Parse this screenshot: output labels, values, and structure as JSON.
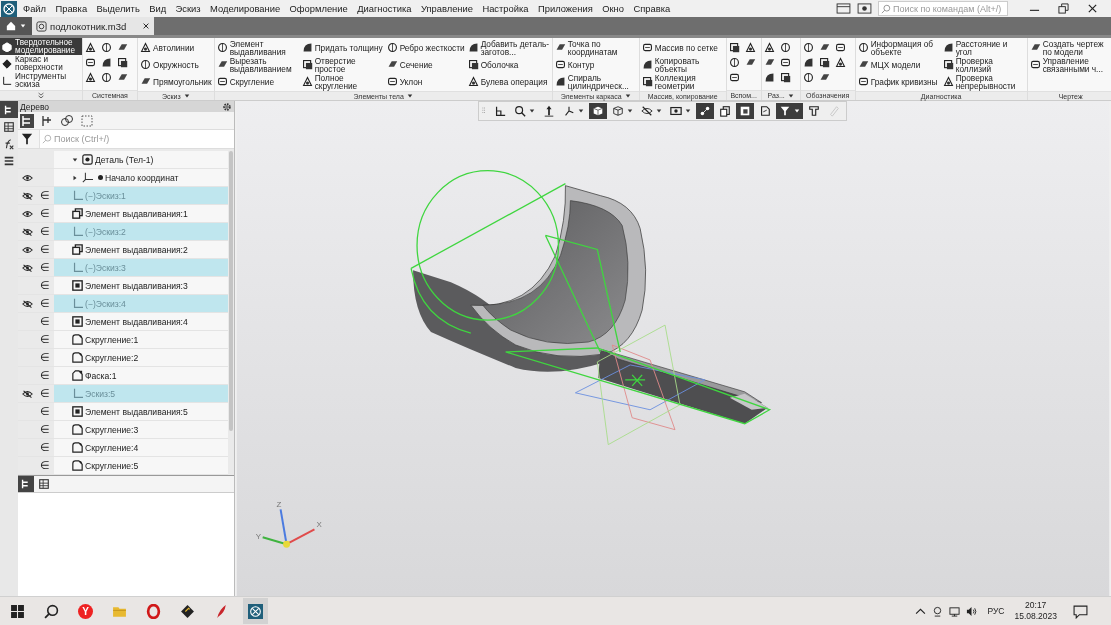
{
  "menu": [
    "Файл",
    "Правка",
    "Выделить",
    "Вид",
    "Эскиз",
    "Моделирование",
    "Оформление",
    "Диагностика",
    "Управление",
    "Настройка",
    "Приложения",
    "Окно",
    "Справка"
  ],
  "command_search": {
    "placeholder": "Поиск по командам (Alt+/)"
  },
  "tabs": [
    {
      "label": "подлокотник.m3d",
      "selected": true
    }
  ],
  "modes": [
    {
      "label": "Твердотельное моделирование",
      "selected": true
    },
    {
      "label": "Каркас и поверхности",
      "selected": false
    },
    {
      "label": "Инструменты эскиза",
      "selected": false
    }
  ],
  "ribbon_groups": [
    {
      "title": "Системная",
      "kind": "system",
      "menu": false
    },
    {
      "title": "Эскиз",
      "kind": "commands",
      "menu": true,
      "commands": [
        "Автолинии",
        "Окружность",
        "Прямоугольник"
      ]
    },
    {
      "title": "Элементы тела",
      "kind": "commands",
      "menu": true,
      "commands": [
        "Элемент выдавливания",
        "Вырезать выдавливанием",
        "Скругление",
        "Придать толщину",
        "Отверстие простое",
        "Полное скругление",
        "Ребро жесткости",
        "Сечение",
        "Уклон",
        "Добавить деталь-заготов...",
        "Оболочка",
        "Булева операция"
      ]
    },
    {
      "title": "Элементы каркаса",
      "kind": "commands",
      "menu": true,
      "commands": [
        "Точка по координатам",
        "Контур",
        "Спираль цилиндрическ..."
      ]
    },
    {
      "title": "Массив, копирование",
      "kind": "commands",
      "menu": false,
      "commands": [
        "Массив по сетке",
        "Копировать объекты",
        "Коллекция геометрии"
      ]
    },
    {
      "title": "Вспом...",
      "kind": "aux",
      "menu": false
    },
    {
      "title": "Раз...",
      "kind": "sections",
      "menu": true
    },
    {
      "title": "Обозначения",
      "kind": "marks",
      "menu": false
    },
    {
      "title": "Диагностика",
      "kind": "commands",
      "menu": false,
      "commands": [
        "Информация об объекте",
        "МЦХ модели",
        "График кривизны",
        "Расстояние и угол",
        "Проверка коллизий",
        "Проверка непрерывности"
      ]
    },
    {
      "title": "Чертеж",
      "kind": "commands",
      "menu": false,
      "commands": [
        "Создать чертеж по модели",
        "Управление связанными ч..."
      ]
    }
  ],
  "side_tabs": [
    {
      "kind": "tree",
      "selected": true
    },
    {
      "kind": "table",
      "selected": false
    },
    {
      "kind": "formula",
      "selected": false
    },
    {
      "kind": "layers",
      "selected": false
    }
  ],
  "tree": {
    "title": "Дерево",
    "search": {
      "placeholder": "Поиск (Ctrl+/)"
    },
    "items": [
      {
        "label": "Деталь (Тел-1)",
        "kind": "part",
        "expanded": true,
        "selected": false,
        "children": [
          {
            "label": "Начало координат",
            "kind": "origin",
            "hidden": false,
            "expanded": false,
            "selected": false
          },
          {
            "label": "(−)Эскиз:1",
            "kind": "sketch",
            "hidden": true,
            "marker": "∈",
            "selected": true
          },
          {
            "label": "Элемент выдавливания:1",
            "kind": "extrude",
            "hidden": false,
            "marker": "∈",
            "selected": false
          },
          {
            "label": "(−)Эскиз:2",
            "kind": "sketch",
            "hidden": true,
            "marker": "∈",
            "selected": true
          },
          {
            "label": "Элемент выдавливания:2",
            "kind": "extrude",
            "hidden": false,
            "marker": "∈",
            "selected": false
          },
          {
            "label": "(−)Эскиз:3",
            "kind": "sketch",
            "hidden": true,
            "marker": "∈",
            "selected": true
          },
          {
            "label": "Элемент выдавливания:3",
            "kind": "cut",
            "marker": "∈",
            "selected": false
          },
          {
            "label": "(−)Эскиз:4",
            "kind": "sketch",
            "hidden": true,
            "marker": "∈",
            "selected": true
          },
          {
            "label": "Элемент выдавливания:4",
            "kind": "cut",
            "marker": "∈",
            "selected": false
          },
          {
            "label": "Скругление:1",
            "kind": "fillet",
            "marker": "∈",
            "selected": false
          },
          {
            "label": "Скругление:2",
            "kind": "fillet",
            "marker": "∈",
            "selected": false
          },
          {
            "label": "Фаска:1",
            "kind": "chamfer",
            "marker": "∈",
            "selected": false
          },
          {
            "label": "Эскиз:5",
            "kind": "sketch",
            "hidden": true,
            "marker": "∈",
            "selected": true
          },
          {
            "label": "Элемент выдавливания:5",
            "kind": "cut",
            "marker": "∈",
            "selected": false
          },
          {
            "label": "Скругление:3",
            "kind": "fillet",
            "marker": "∈",
            "selected": false
          },
          {
            "label": "Скругление:4",
            "kind": "fillet",
            "marker": "∈",
            "selected": false
          },
          {
            "label": "Скругление:5",
            "kind": "fillet",
            "marker": "∈",
            "selected": false
          }
        ]
      }
    ],
    "bottom_tabs": [
      {
        "kind": "tree",
        "selected": true
      },
      {
        "kind": "table",
        "selected": false
      }
    ]
  },
  "view_toolbar": [
    {
      "kind": "orient",
      "active": false,
      "menu": false,
      "disabled": false
    },
    {
      "kind": "zoom",
      "active": false,
      "menu": true,
      "disabled": false
    },
    {
      "kind": "pan",
      "active": false,
      "menu": false,
      "disabled": false
    },
    {
      "kind": "rotate",
      "active": false,
      "menu": true,
      "disabled": false
    },
    {
      "kind": "shaded",
      "active": true,
      "menu": false,
      "disabled": false
    },
    {
      "kind": "wire",
      "active": false,
      "menu": true,
      "disabled": false
    },
    {
      "kind": "hide",
      "active": false,
      "menu": true,
      "disabled": false
    },
    {
      "kind": "display",
      "active": false,
      "menu": true,
      "disabled": false
    },
    {
      "kind": "constraints",
      "active": true,
      "menu": false,
      "disabled": false
    },
    {
      "kind": "copy",
      "active": false,
      "menu": false,
      "disabled": false
    },
    {
      "kind": "layers",
      "active": true,
      "menu": false,
      "disabled": false
    },
    {
      "kind": "sheet",
      "active": false,
      "menu": false,
      "disabled": false
    },
    {
      "kind": "filter",
      "active": true,
      "menu": true,
      "disabled": false
    },
    {
      "kind": "tool",
      "active": false,
      "menu": false,
      "disabled": false
    },
    {
      "kind": "pencil",
      "active": false,
      "menu": false,
      "disabled": true
    }
  ],
  "axes": [
    "X",
    "Y",
    "Z"
  ],
  "taskbar": {
    "yandex_letter": "Y",
    "language": "РУС",
    "time": "20:17",
    "date": "15.08.2023"
  }
}
